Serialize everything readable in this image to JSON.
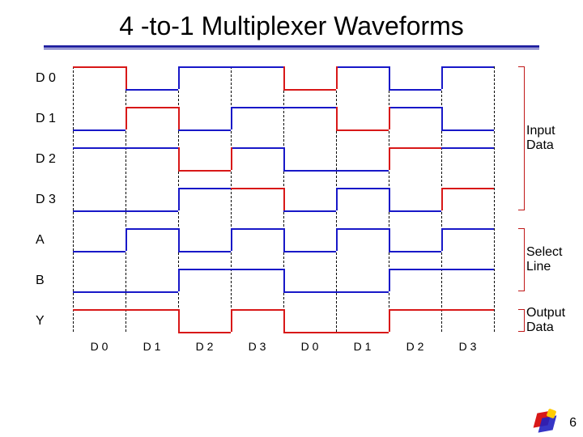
{
  "title": "4 -to-1 Multiplexer Waveforms",
  "page_number": "6",
  "group_labels": {
    "input": "Input\nData",
    "select": "Select\nLine",
    "output": "Output\nData"
  },
  "chart_data": {
    "type": "timing-diagram",
    "time_divisions": 8,
    "signals": [
      {
        "name": "D 0",
        "group": "input",
        "levels": [
          1,
          0,
          1,
          1,
          0,
          1,
          0,
          1
        ],
        "highlight_div": [
          0,
          4
        ]
      },
      {
        "name": "D 1",
        "group": "input",
        "levels": [
          0,
          1,
          0,
          1,
          1,
          0,
          1,
          0
        ],
        "highlight_div": [
          1,
          5
        ]
      },
      {
        "name": "D 2",
        "group": "input",
        "levels": [
          1,
          1,
          0,
          1,
          0,
          0,
          1,
          1
        ],
        "highlight_div": [
          2,
          6
        ]
      },
      {
        "name": "D 3",
        "group": "input",
        "levels": [
          0,
          0,
          1,
          1,
          0,
          1,
          0,
          1
        ],
        "highlight_div": [
          3,
          7
        ]
      },
      {
        "name": "A",
        "group": "select",
        "levels": [
          0,
          1,
          0,
          1,
          0,
          1,
          0,
          1
        ],
        "highlight_div": []
      },
      {
        "name": "B",
        "group": "select",
        "levels": [
          0,
          0,
          1,
          1,
          0,
          0,
          1,
          1
        ],
        "highlight_div": []
      },
      {
        "name": "Y",
        "group": "output",
        "levels": [
          1,
          1,
          0,
          1,
          0,
          0,
          1,
          1
        ],
        "highlight_div": [
          0,
          1,
          2,
          3,
          4,
          5,
          6,
          7
        ]
      }
    ],
    "selection_sequence": [
      "D 0",
      "D 1",
      "D 2",
      "D 3",
      "D 0",
      "D 1",
      "D 2",
      "D 3"
    ]
  }
}
